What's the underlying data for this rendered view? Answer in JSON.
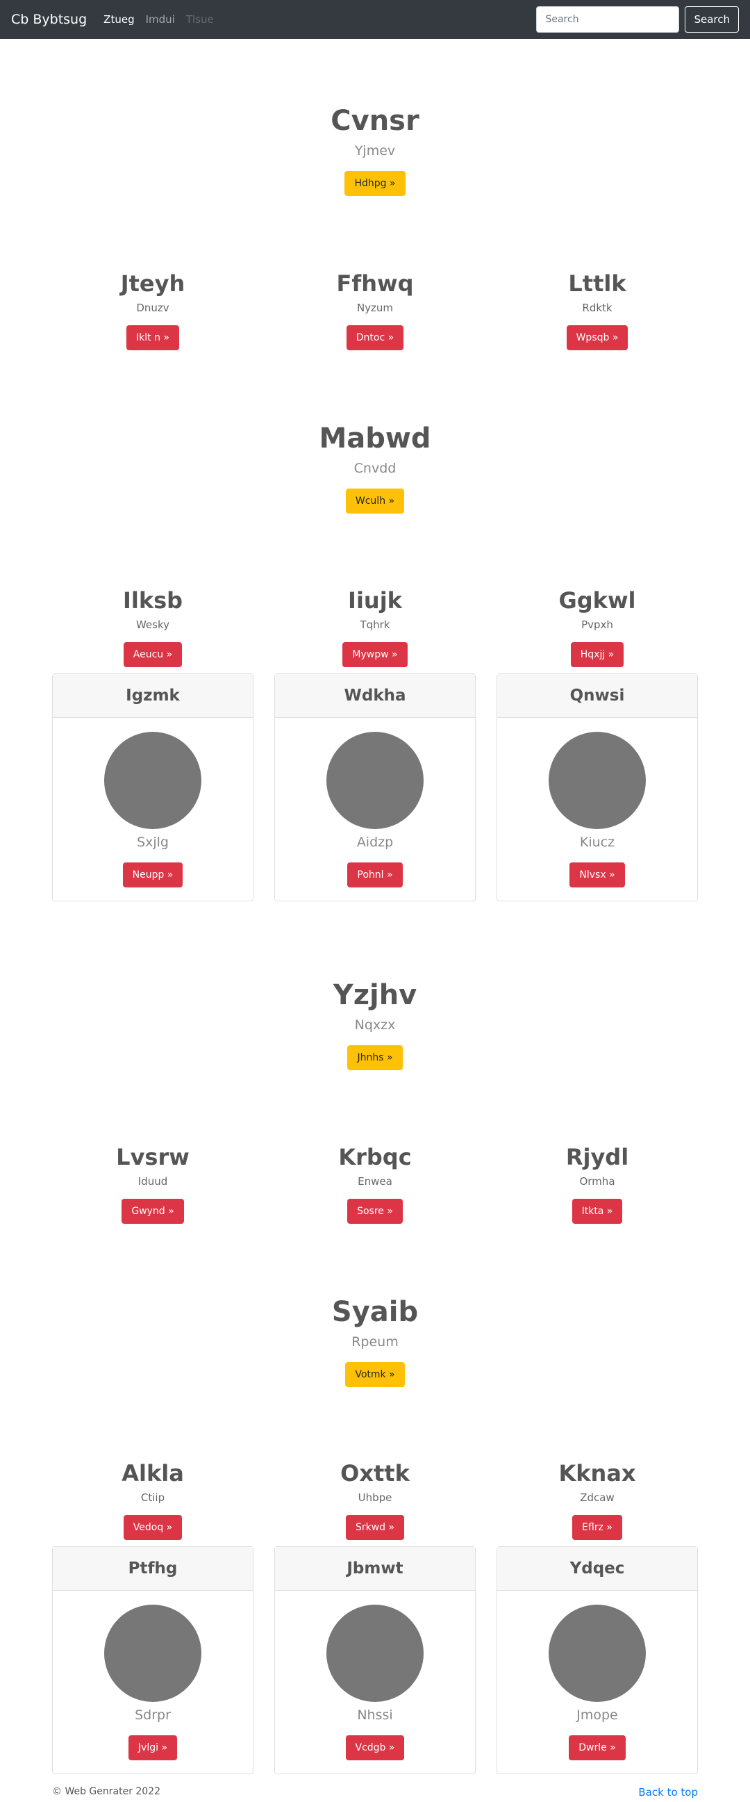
{
  "navbar": {
    "brand": "Cb Bybtsug",
    "links": [
      {
        "label": "Ztueg",
        "state": "active"
      },
      {
        "label": "Imdui",
        "state": "normal"
      },
      {
        "label": "Tlsue",
        "state": "disabled"
      }
    ],
    "search_placeholder": "Search",
    "search_button": "Search"
  },
  "sections": {
    "hero1": {
      "title": "Cvnsr",
      "subtitle": "Yjmev",
      "button": "Hdhpg »"
    },
    "row1": [
      {
        "title": "Jteyh",
        "subtitle": "Dnuzv",
        "button": "Iklt n »"
      },
      {
        "title": "Ffhwq",
        "subtitle": "Nyzum",
        "button": "Dntoc »"
      },
      {
        "title": "Lttlk",
        "subtitle": "Rdktk",
        "button": "Wpsqb »"
      }
    ],
    "hero2": {
      "title": "Mabwd",
      "subtitle": "Cnvdd",
      "button": "Wculh »"
    },
    "row2": [
      {
        "title": "Ilksb",
        "subtitle": "Wesky",
        "button": "Aeucu »"
      },
      {
        "title": "Iiujk",
        "subtitle": "Tqhrk",
        "button": "Mywpw »"
      },
      {
        "title": "Ggkwl",
        "subtitle": "Pvpxh",
        "button": "Hqxjj »"
      }
    ],
    "cards1": [
      {
        "header": "Igzmk",
        "name": "Sxjlg",
        "button": "Neupp »"
      },
      {
        "header": "Wdkha",
        "name": "Aidzp",
        "button": "Pohnl »"
      },
      {
        "header": "Qnwsi",
        "name": "Kiucz",
        "button": "Nlvsx »"
      }
    ],
    "hero3": {
      "title": "Yzjhv",
      "subtitle": "Nqxzx",
      "button": "Jhnhs »"
    },
    "row3": [
      {
        "title": "Lvsrw",
        "subtitle": "Iduud",
        "button": "Gwynd »"
      },
      {
        "title": "Krbqc",
        "subtitle": "Enwea",
        "button": "Sosre »"
      },
      {
        "title": "Rjydl",
        "subtitle": "Ormha",
        "button": "Itkta »"
      }
    ],
    "hero4": {
      "title": "Syaib",
      "subtitle": "Rpeum",
      "button": "Votmk »"
    },
    "row4": [
      {
        "title": "Alkla",
        "subtitle": "Ctiip",
        "button": "Vedoq »"
      },
      {
        "title": "Oxttk",
        "subtitle": "Uhbpe",
        "button": "Srkwd »"
      },
      {
        "title": "Kknax",
        "subtitle": "Zdcaw",
        "button": "Eflrz »"
      }
    ],
    "cards2": [
      {
        "header": "Ptfhg",
        "name": "Sdrpr",
        "button": "Jvlgi »"
      },
      {
        "header": "Jbmwt",
        "name": "Nhssi",
        "button": "Vcdgb »"
      },
      {
        "header": "Ydqec",
        "name": "Jmope",
        "button": "Dwrle »"
      }
    ]
  },
  "footer": {
    "copyright": "© Web Genrater 2022",
    "back_to_top": "Back to top"
  },
  "colors": {
    "navbar_bg": "#343a40",
    "warning": "#ffc107",
    "danger": "#dc3545",
    "link": "#007bff",
    "avatar": "#777777"
  }
}
